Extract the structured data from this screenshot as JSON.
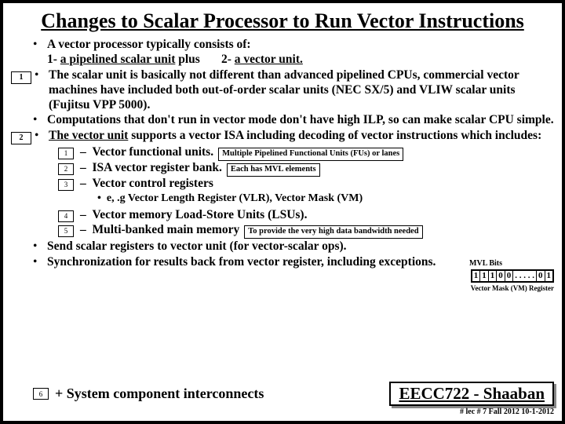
{
  "title": "Changes to Scalar Processor to Run Vector Instructions",
  "b1a": "A vector processor typically consists of:",
  "b1b": "1- ",
  "b1c": "a pipelined scalar unit",
  "b1d": " plus",
  "b1e": "2- ",
  "b1f": "a vector unit.",
  "m1": "1",
  "b2": "The scalar unit is basically not different than advanced pipelined CPUs, commercial vector machines have included both out-of-order scalar units (NEC SX/5) and VLIW scalar units (Fujitsu VPP 5000).",
  "b3": "Computations that don't run in vector mode don't have high ILP, so can make scalar CPU simple.",
  "m2": "2",
  "b4a": "The vector unit",
  "b4b": " supports a vector ISA including decoding of vector instructions which includes:",
  "s1": "1",
  "s1t": "Vector functional units.",
  "s1n": "Multiple Pipelined Functional Units (FUs) or lanes",
  "s2": "2",
  "s2t": "ISA vector register bank.",
  "s2n": "Each has MVL elements",
  "s3": "3",
  "s3t": "Vector control registers",
  "vlr": "e, .g   Vector Length Register (VLR), Vector Mask (VM)",
  "mvl": "MVL Bits",
  "bits": [
    "1",
    "1",
    "1",
    "0",
    "0"
  ],
  "bitsend": [
    "0",
    "1"
  ],
  "dots": ". . . . .",
  "vmr": "Vector Mask (VM) Register",
  "s4": "4",
  "s4t": "Vector memory Load-Store Units (LSUs).",
  "s5": "5",
  "s5t": "Multi-banked main memory",
  "s5n": "To provide the very high data bandwidth needed",
  "b5": "Send scalar registers to vector unit  (for vector-scalar ops).",
  "b6": "Synchronization for results back from vector register, including exceptions.",
  "s6": "6",
  "sys": "+ System component interconnects",
  "course": "EECC722 - Shaaban",
  "foot": "#  lec # 7    Fall 2012   10-1-2012"
}
